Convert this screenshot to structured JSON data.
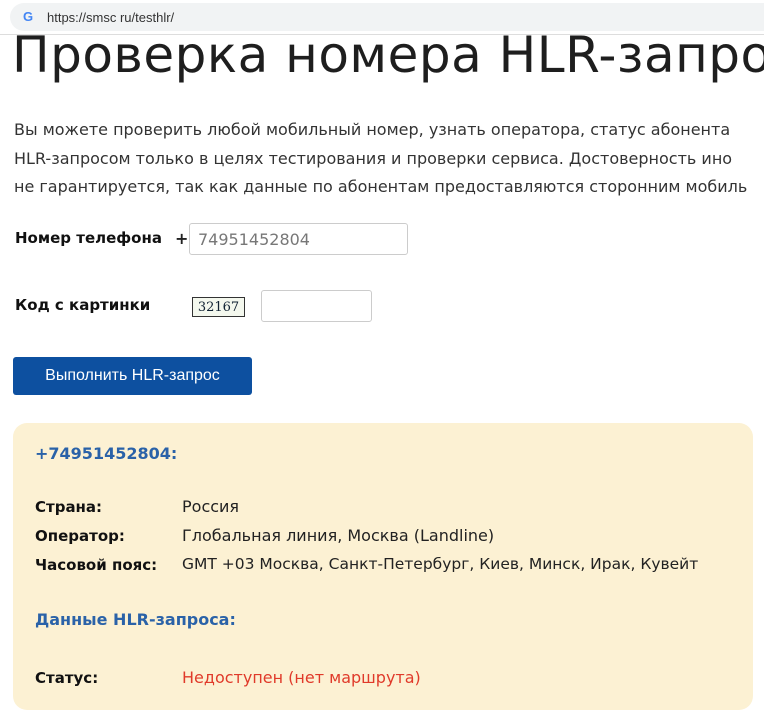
{
  "browser": {
    "url": "https://smsc ru/testhlr/",
    "favicon": "G"
  },
  "page": {
    "title": "Проверка номера HLR-запро",
    "intro": [
      "Вы можете проверить любой мобильный номер, узнать оператора, статус абонента",
      "HLR-запросом только в целях тестирования и проверки сервиса. Достоверность ино",
      "не гарантируется, так как данные по абонентам предоставляются сторонним мобиль"
    ],
    "form": {
      "phone_label": "Номер телефона",
      "plus": "+",
      "phone_value": "74951452804",
      "captcha_label": "Код с картинки",
      "captcha_code": "32167",
      "captcha_value": "",
      "submit": "Выполнить HLR-запрос"
    },
    "result": {
      "number": "+74951452804:",
      "rows": [
        {
          "k": "Страна:",
          "v": "Россия"
        },
        {
          "k": "Оператор:",
          "v": "Глобальная линия, Москва (Landline)"
        },
        {
          "k": "Часовой пояс:",
          "v": "GMT +03 Москва, Санкт-Петербург, Киев, Минск, Ирак, Кувейт"
        }
      ],
      "hlr_heading": "Данные HLR-запроса:",
      "status_label": "Статус:",
      "status_value": "Недоступен (нет маршрута)",
      "status_color": "#e03a2a"
    }
  }
}
